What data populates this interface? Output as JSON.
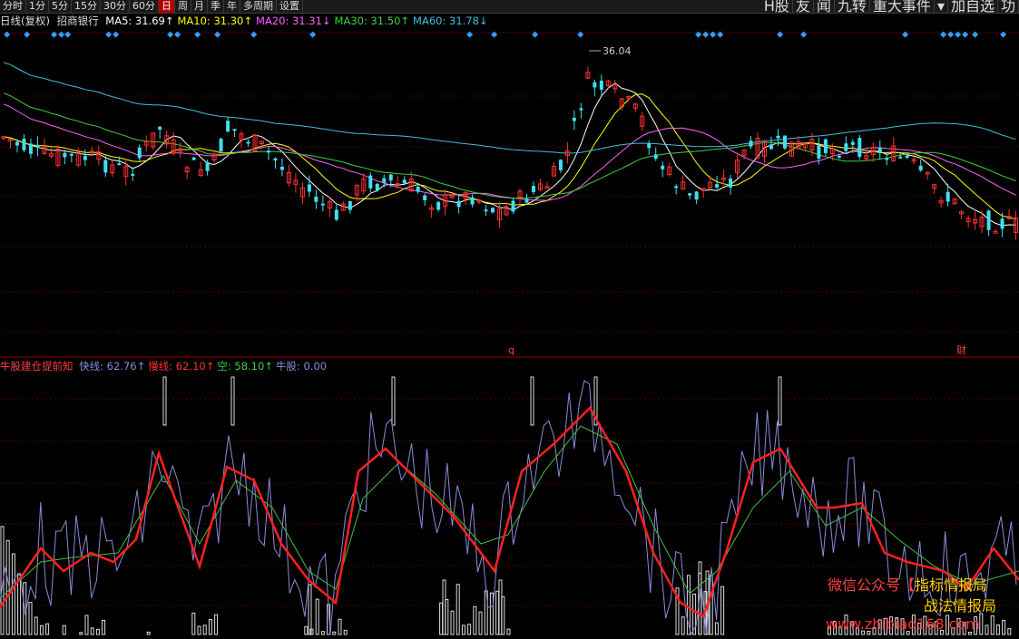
{
  "toolbar": {
    "left": [
      "分时",
      "1分",
      "5分",
      "15分",
      "30分",
      "60分",
      "日",
      "周",
      "月",
      "季",
      "年",
      "多周期",
      "设置"
    ],
    "active": "日",
    "right": [
      "H股",
      "友",
      "闻",
      "九转",
      "重大事件",
      "▾",
      "加自选",
      "功"
    ]
  },
  "main_legend": {
    "period": "日线(复权)",
    "stock": "招商银行",
    "items": [
      {
        "label": "MA5: 31.69",
        "arrow": "↑",
        "color": "#ffffff"
      },
      {
        "label": "MA10: 31.30",
        "arrow": "↑",
        "color": "#ffff00"
      },
      {
        "label": "MA20: 31.31",
        "arrow": "↓",
        "color": "#ff60ff"
      },
      {
        "label": "MA30: 31.50",
        "arrow": "↑",
        "color": "#40d040"
      },
      {
        "label": "MA60: 31.78",
        "arrow": "↓",
        "color": "#40c0e0"
      }
    ]
  },
  "max_label": "36.04",
  "event_marks": [
    {
      "text": "q"
    },
    {
      "text": "财"
    }
  ],
  "indicator_legend": {
    "name": "牛股建仓提前知",
    "items": [
      {
        "label": "快线: 62.76",
        "arrow": "↑",
        "color": "#8b8bd8"
      },
      {
        "label": "慢线: 62.10",
        "arrow": "↑",
        "color": "#ff3030"
      },
      {
        "label": "空: 58.10",
        "arrow": "↑",
        "color": "#40d040"
      },
      {
        "label": "牛股: 0.00",
        "arrow": "",
        "color": "#8b8bd8"
      }
    ]
  },
  "watermark": {
    "line1_prefix": "微信公众号",
    "line1_bracket_open": "【",
    "line1_name": "指标情报局",
    "line2": "战法情报局",
    "url": "www.zhibiao168.com"
  },
  "chart_data": {
    "type": "candlestick",
    "ma_colors": {
      "ma5": "#ffffff",
      "ma10": "#ffff00",
      "ma20": "#ff60ff",
      "ma30": "#40d040",
      "ma60": "#40c0e0"
    },
    "up_color": "#ff3030",
    "down_color": "#40e0f0",
    "indicator_colors": {
      "fast": "#8b8bd8",
      "slow": "#ff2020",
      "empty": "#40c040",
      "bars": "#dddddd"
    }
  }
}
